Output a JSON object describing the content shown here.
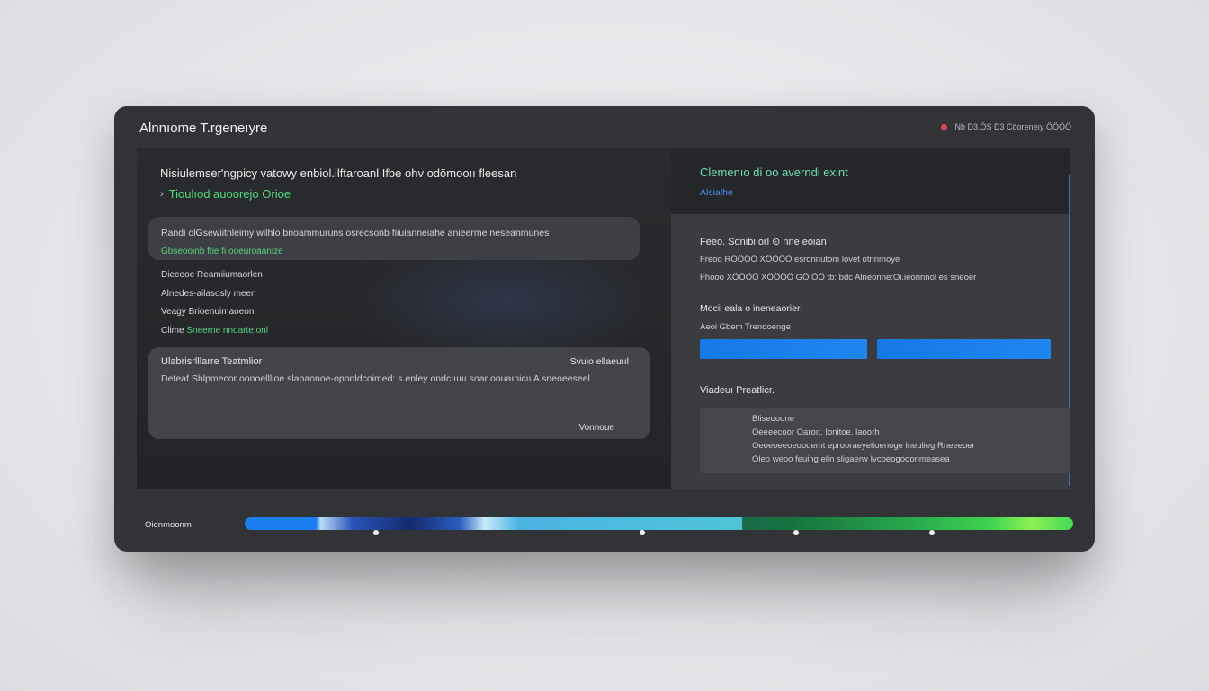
{
  "window": {
    "title": "Alnnıome T.rgeneıyre",
    "status_text": "Nb D3.ÖS D3 Cöoreneıy ÖÖÖÖ",
    "status_color": "#e0475b"
  },
  "left": {
    "heading": "Nisiulemser'ngpicy vatowy enbiol.ilftaroanl Ifbe ohv odömooıı fleesan",
    "subheading": "Tioulıod auoorejo Orioe",
    "card1_text": "Randi olGsewiitnleimy wilhlo bnoammuruns osrecsonb fiiuianneiahe anieerme neseanmunes",
    "card1_green": "Gbseooinb ftie fi ooeuroaanize",
    "items": [
      {
        "label": "Dieeooe Reamiiumaorlen"
      },
      {
        "label": "Alnedes-ailasosly meen"
      },
      {
        "label": "Veagy Brioenuimaoeonl"
      },
      {
        "label": "Clime ",
        "green": "Sneerne nnoarte.onl"
      }
    ],
    "card2": {
      "title": "Ulabrisrlllarre Teatmlior",
      "right": "Svuio ellaeuııl",
      "body": "Deteaf Shlpmecor oonoelllioe slapaonoe-oponldcoimed: s.enley ondcıııııı soar oouaınicıı A sneoeeseel",
      "footer": "Vonnoue"
    }
  },
  "right": {
    "title": "Clemenıo di oo averndi exint",
    "link": "Alsialhe",
    "form_label": "Feeo. Sonibi orl ⊙ nne eoian",
    "form_lines": [
      "Freoo RÖÖÖÖ XÖÖÖÖ esronnutom lovet otnnmoye",
      "Fhooo XÖÖÖÖ XÖÖÖÖ GÖ ÖÖ tb: bdc Alneonne:Oi.ieonnnol es sneoer"
    ],
    "model_label": "Mocii eala o ineneaorier",
    "model_sub": "Aeoi Gbem Trenooenge",
    "btn1": "",
    "btn2": "",
    "pref_label": "Viadeuı Preatlicr.",
    "pref_lines": [
      "Bliseooone",
      "Oeeeecoor Oaroıt. Ionitoe. laoorh",
      "Oeoeoeeoeoodemt eprooraeyelioenoge lneulieg Rneeeoer",
      "Oleo weoo feuing elin sligaerw Ivcbeogooonmeasea"
    ]
  },
  "footer": {
    "label": "Oienmoonm",
    "progress_stops": [
      0.086,
      0.6
    ],
    "markers": [
      0.159,
      0.48,
      0.666,
      0.83
    ]
  }
}
